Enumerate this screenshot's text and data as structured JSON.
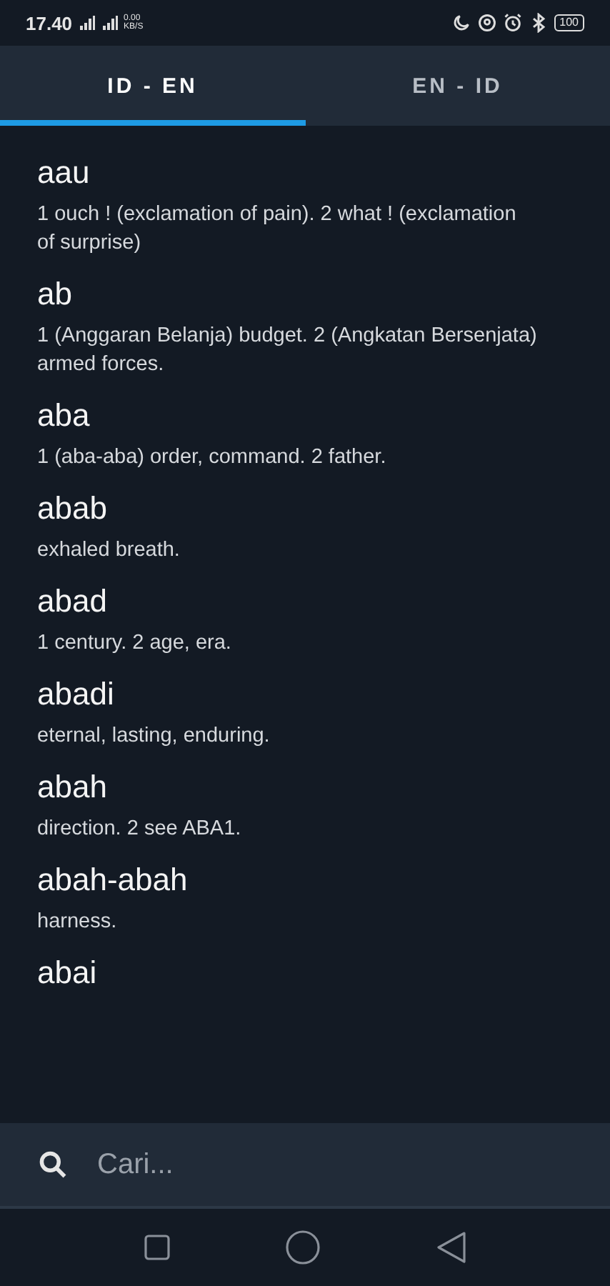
{
  "status_bar": {
    "time": "17.40",
    "net_speed": "0.00",
    "net_unit": "KB/S",
    "battery": "100"
  },
  "tabs": [
    {
      "label": "ID - EN",
      "selected": true
    },
    {
      "label": "EN - ID",
      "selected": false
    }
  ],
  "entries": [
    {
      "word": "aau",
      "definition": "1 ouch ! (exclamation of pain). 2 what ! (exclamation of surprise)"
    },
    {
      "word": "ab",
      "definition": "1 (Anggaran Belanja)  budget. 2 (Angkatan Bersenjata)  armed forces."
    },
    {
      "word": "aba",
      "definition": "1 (aba-aba) order, command. 2  father."
    },
    {
      "word": "abab",
      "definition": "exhaled breath."
    },
    {
      "word": "abad",
      "definition": "1 century. 2 age, era."
    },
    {
      "word": "abadi",
      "definition": "eternal, lasting, enduring."
    },
    {
      "word": "abah",
      "definition": "direction. 2 see  ABA1."
    },
    {
      "word": "abah-abah",
      "definition": "harness."
    },
    {
      "word": "abai"
    }
  ],
  "search": {
    "placeholder": "Cari..."
  }
}
